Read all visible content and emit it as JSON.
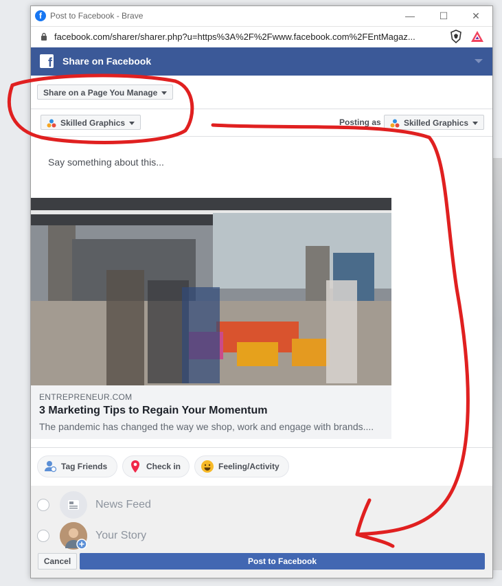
{
  "window": {
    "title": "Post to Facebook - Brave",
    "url": "facebook.com/sharer/sharer.php?u=https%3A%2F%2Fwww.facebook.com%2FEntMagaz...",
    "controls": {
      "minimize": "—",
      "maximize": "☐",
      "close": "✕"
    }
  },
  "header": {
    "logo": "f",
    "title": "Share on Facebook"
  },
  "share_target": {
    "label": "Share on a Page You Manage"
  },
  "page_select": {
    "label": "Skilled Graphics"
  },
  "posting_as": {
    "label": "Posting as",
    "value": "Skilled Graphics"
  },
  "composer": {
    "placeholder": "Say something about this..."
  },
  "link_preview": {
    "domain": "ENTREPRENEUR.COM",
    "title": "3 Marketing Tips to Regain Your Momentum",
    "description": "The pandemic has changed the way we shop, work and engage with brands...."
  },
  "actions": [
    {
      "label": "Tag Friends"
    },
    {
      "label": "Check in"
    },
    {
      "label": "Feeling/Activity"
    }
  ],
  "destinations": [
    {
      "label": "News Feed"
    },
    {
      "label": "Your Story"
    }
  ],
  "footer": {
    "cancel": "Cancel",
    "post": "Post to Facebook"
  },
  "colors": {
    "facebook_blue": "#3b5998",
    "post_button": "#4267b2",
    "annotation_red": "#e02020"
  }
}
